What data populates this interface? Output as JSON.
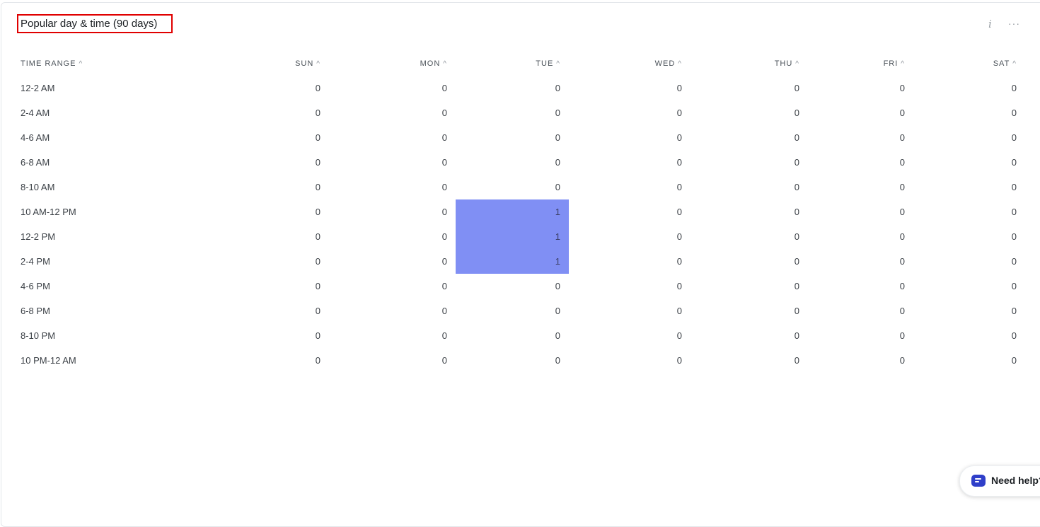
{
  "widget": {
    "title": "Popular day & time (90 days)",
    "info_icon": "i",
    "more_icon": "···"
  },
  "table": {
    "headers": [
      "TIME RANGE",
      "SUN",
      "MON",
      "TUE",
      "WED",
      "THU",
      "FRI",
      "SAT"
    ],
    "sort_arrow": "^",
    "rows": [
      {
        "range": "12-2 AM",
        "values": [
          "0",
          "0",
          "0",
          "0",
          "0",
          "0",
          "0"
        ]
      },
      {
        "range": "2-4 AM",
        "values": [
          "0",
          "0",
          "0",
          "0",
          "0",
          "0",
          "0"
        ]
      },
      {
        "range": "4-6 AM",
        "values": [
          "0",
          "0",
          "0",
          "0",
          "0",
          "0",
          "0"
        ]
      },
      {
        "range": "6-8 AM",
        "values": [
          "0",
          "0",
          "0",
          "0",
          "0",
          "0",
          "0"
        ]
      },
      {
        "range": "8-10 AM",
        "values": [
          "0",
          "0",
          "0",
          "0",
          "0",
          "0",
          "0"
        ]
      },
      {
        "range": "10 AM-12 PM",
        "values": [
          "0",
          "0",
          "1",
          "0",
          "0",
          "0",
          "0"
        ]
      },
      {
        "range": "12-2 PM",
        "values": [
          "0",
          "0",
          "1",
          "0",
          "0",
          "0",
          "0"
        ]
      },
      {
        "range": "2-4 PM",
        "values": [
          "0",
          "0",
          "1",
          "0",
          "0",
          "0",
          "0"
        ]
      },
      {
        "range": "4-6 PM",
        "values": [
          "0",
          "0",
          "0",
          "0",
          "0",
          "0",
          "0"
        ]
      },
      {
        "range": "6-8 PM",
        "values": [
          "0",
          "0",
          "0",
          "0",
          "0",
          "0",
          "0"
        ]
      },
      {
        "range": "8-10 PM",
        "values": [
          "0",
          "0",
          "0",
          "0",
          "0",
          "0",
          "0"
        ]
      },
      {
        "range": "10 PM-12 AM",
        "values": [
          "0",
          "0",
          "0",
          "0",
          "0",
          "0",
          "0"
        ]
      }
    ]
  },
  "help_widget": {
    "label": "Need help?",
    "icon": "chat-icon"
  },
  "colors": {
    "highlight": "#808ff4",
    "title_outline": "#e00000",
    "help_icon": "#2f3fc9"
  }
}
